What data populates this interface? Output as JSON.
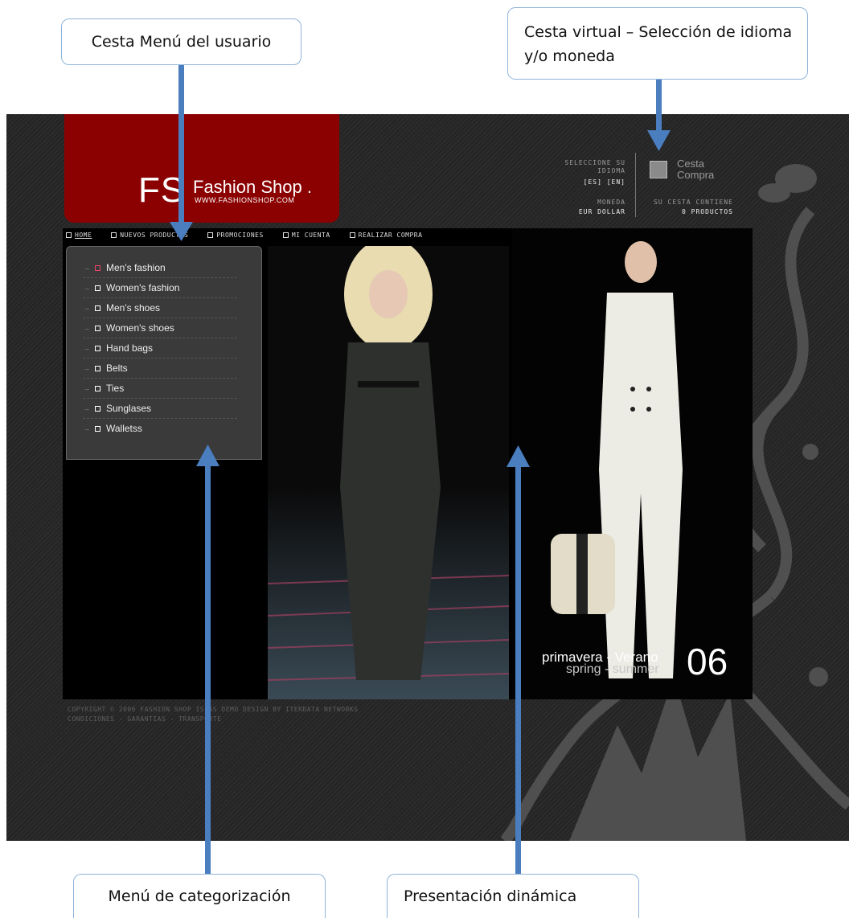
{
  "callouts": {
    "user_menu": "Cesta Menú del usuario",
    "cart_lang": "Cesta virtual – Selección de idioma y/o moneda",
    "categories": "Menú de categorización",
    "presentation": "Presentación dinámica"
  },
  "site": {
    "logo": {
      "initials": "FS",
      "name": "Fashion Shop .",
      "url": "WWW.FASHIONSHOP.COM"
    },
    "language": {
      "label": "SELECCIONE SU IDIOMA",
      "options": "[ES] [EN]"
    },
    "currency": {
      "label": "MONEDA",
      "options": "EUR DOLLAR"
    },
    "cart": {
      "title": "Cesta Compra",
      "contains_label": "SU CESTA CONTIENE",
      "count": "0 PRODUCTOS"
    },
    "nav": [
      "HOME",
      "NUEVOS PRODUCTOS",
      "PROMOCIONES",
      "MI CUENTA",
      "REALIZAR COMPRA"
    ],
    "categories": [
      "Men's fashion",
      "Women's fashion",
      "Men's shoes",
      "Women's shoes",
      "Hand bags",
      "Belts",
      "Ties",
      "Sunglases",
      "Walletss"
    ],
    "season": {
      "es": "primavera - Verano",
      "en": "spring - summer",
      "number": "06"
    },
    "footer": {
      "copyright": "COPYRIGHT © 2006 FASHION SHOP IS AS DEMO DESIGN BY ITERDATA NETWORKS",
      "links": "CONDICIONES - GARANTIAS - TRANSPORTE"
    }
  },
  "colors": {
    "brand_red": "#8b0000",
    "arrow_blue": "#4a7ebf",
    "callout_border": "#8fb4d9"
  }
}
